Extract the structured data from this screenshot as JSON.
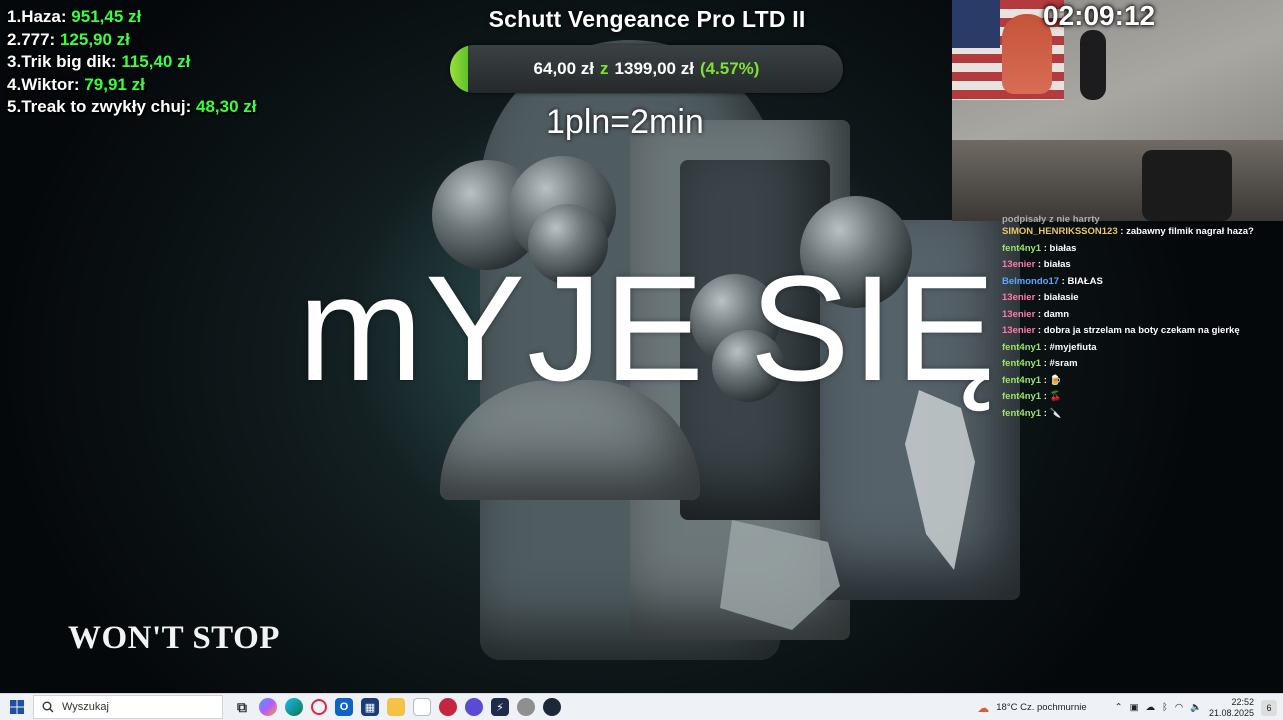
{
  "leaderboard": [
    {
      "rank": "1.",
      "name": "Haza:",
      "amount": "951,45 zł"
    },
    {
      "rank": "2.",
      "name": "777:",
      "amount": "125,90 zł"
    },
    {
      "rank": "3.",
      "name": "Trik big dik:",
      "amount": "115,40 zł"
    },
    {
      "rank": "4.",
      "name": "Wiktor:",
      "amount": "79,91 zł"
    },
    {
      "rank": "5.",
      "name": "Treak to zwykły chuj:",
      "amount": "48,30 zł"
    }
  ],
  "goal": {
    "title": "Schutt Vengeance Pro LTD II",
    "current": "64,00 zł",
    "separator": "z",
    "target": "1399,00 zł",
    "percent_label": "(4.57%)",
    "progress": 0.0457,
    "fill_color": "#7ee233"
  },
  "rate_text": "1pln=2min",
  "overlay_text": "mYJE SIĘ",
  "wont_stop": "WON'T STOP",
  "timer": "02:09:12",
  "chat": {
    "cut_line": "podpisały z nie harrty",
    "messages": [
      {
        "user": "SIMON_HENRIKSSON123",
        "color": "#e9c46a",
        "text": ": zabawny filmik nagrał haza?"
      },
      {
        "user": "fent4ny1",
        "color": "#9be36b",
        "text": ": białas"
      },
      {
        "user": "13enier",
        "color": "#ff7aa8",
        "text": ": białas"
      },
      {
        "user": "Belmondo17",
        "color": "#5aa7ff",
        "text": ": BIAŁAS"
      },
      {
        "user": "13enier",
        "color": "#ff7aa8",
        "text": ": białasie"
      },
      {
        "user": "13enier",
        "color": "#ff7aa8",
        "text": ": damn"
      },
      {
        "user": "13enier",
        "color": "#ff7aa8",
        "text": ": dobra ja strzelam na boty czekam na gierkę"
      },
      {
        "user": "fent4ny1",
        "color": "#9be36b",
        "text": ": #myjefiuta"
      },
      {
        "user": "fent4ny1",
        "color": "#9be36b",
        "text": ": #sram"
      },
      {
        "user": "fent4ny1",
        "color": "#9be36b",
        "text": ": 🍺"
      },
      {
        "user": "fent4ny1",
        "color": "#9be36b",
        "text": ": 🍒"
      },
      {
        "user": "fent4ny1",
        "color": "#9be36b",
        "text": ": 🔪"
      }
    ]
  },
  "taskbar": {
    "search_placeholder": "Wyszukaj",
    "weather": "18°C  Cz. pochmurnie",
    "time": "22:52",
    "date": "21.08.2025",
    "notification_count": "6"
  }
}
